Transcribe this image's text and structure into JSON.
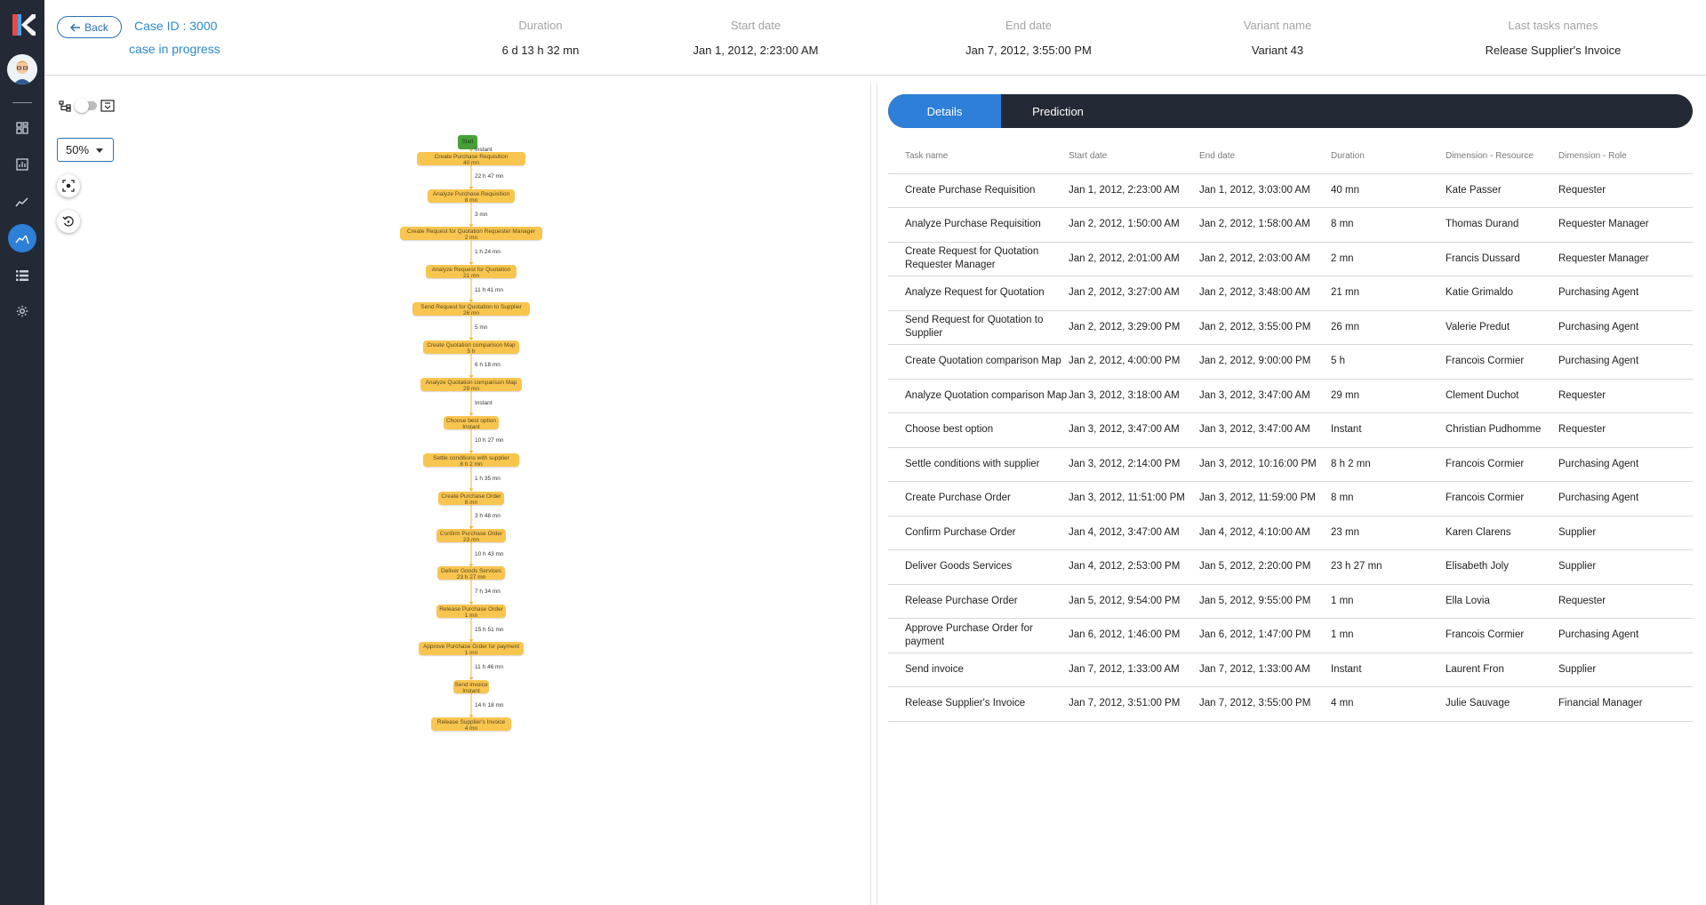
{
  "header": {
    "back_label": "Back",
    "case_id": "Case ID : 3000",
    "case_status": "case in progress",
    "columns": [
      {
        "label": "Duration",
        "value": "6 d 13 h 32 mn"
      },
      {
        "label": "Start date",
        "value": "Jan 1, 2012, 2:23:00 AM"
      },
      {
        "label": "End date",
        "value": "Jan 7, 2012, 3:55:00 PM"
      },
      {
        "label": "Variant name",
        "value": "Variant 43"
      },
      {
        "label": "Last tasks names",
        "value": "Release Supplier's Invoice"
      }
    ]
  },
  "sidebar": {
    "items": [
      {
        "icon": "dashboard-icon"
      },
      {
        "icon": "bar-chart-icon"
      },
      {
        "icon": "trend-line-icon"
      },
      {
        "icon": "process-map-icon",
        "active": true
      },
      {
        "icon": "list-icon"
      },
      {
        "icon": "gear-icon"
      }
    ]
  },
  "flow_controls": {
    "zoom": "50%"
  },
  "flow": {
    "start_label": "Start",
    "nodes": [
      {
        "name": "Create Purchase Requisition",
        "duration": "40 mn"
      },
      {
        "name": "Analyze Purchase Requisition",
        "duration": "8 mn"
      },
      {
        "name": "Create Request for Quotation Requester Manager",
        "duration": "2 mn"
      },
      {
        "name": "Analyze Request for Quotation",
        "duration": "21 mn"
      },
      {
        "name": "Send Request for Quotation to Supplier",
        "duration": "26 mn"
      },
      {
        "name": "Create Quotation comparison Map",
        "duration": "5 h"
      },
      {
        "name": "Analyze Quotation comparison Map",
        "duration": "29 mn"
      },
      {
        "name": "Choose best option",
        "duration": "Instant"
      },
      {
        "name": "Settle conditions with supplier",
        "duration": "8 h 2 mn"
      },
      {
        "name": "Create Purchase Order",
        "duration": "8 mn"
      },
      {
        "name": "Confirm Purchase Order",
        "duration": "23 mn"
      },
      {
        "name": "Deliver Goods Services",
        "duration": "23 h 27 mn"
      },
      {
        "name": "Release Purchase Order",
        "duration": "1 mn"
      },
      {
        "name": "Approve Purchase Order for payment",
        "duration": "1 mn"
      },
      {
        "name": "Send invoice",
        "duration": "Instant"
      },
      {
        "name": "Release Supplier's Invoice",
        "duration": "4 mn"
      }
    ],
    "edges": [
      "Instant",
      "22 h 47 mn",
      "3 mn",
      "1 h 24 mn",
      "11 h 41 mn",
      "5 mn",
      "6 h 18 mn",
      "Instant",
      "10 h 27 mn",
      "1 h 35 mn",
      "3 h 48 mn",
      "10 h 43 mn",
      "7 h 34 mn",
      "15 h 51 mn",
      "11 h 46 mn",
      "14 h 18 mn"
    ]
  },
  "tabs": [
    {
      "label": "Details",
      "active": true
    },
    {
      "label": "Prediction",
      "active": false
    }
  ],
  "table": {
    "columns": [
      "Task name",
      "Start date",
      "End date",
      "Duration",
      "Dimension - Resource",
      "Dimension - Role"
    ],
    "rows": [
      [
        "Create Purchase Requisition",
        "Jan 1, 2012, 2:23:00 AM",
        "Jan 1, 2012, 3:03:00 AM",
        "40 mn",
        "Kate Passer",
        "Requester"
      ],
      [
        "Analyze Purchase Requisition",
        "Jan 2, 2012, 1:50:00 AM",
        "Jan 2, 2012, 1:58:00 AM",
        "8 mn",
        "Thomas Durand",
        "Requester Manager"
      ],
      [
        "Create Request for Quotation Requester Manager",
        "Jan 2, 2012, 2:01:00 AM",
        "Jan 2, 2012, 2:03:00 AM",
        "2 mn",
        "Francis Dussard",
        "Requester Manager"
      ],
      [
        "Analyze Request for Quotation",
        "Jan 2, 2012, 3:27:00 AM",
        "Jan 2, 2012, 3:48:00 AM",
        "21 mn",
        "Katie Grimaldo",
        "Purchasing Agent"
      ],
      [
        "Send Request for Quotation to Supplier",
        "Jan 2, 2012, 3:29:00 PM",
        "Jan 2, 2012, 3:55:00 PM",
        "26 mn",
        "Valerie Predut",
        "Purchasing Agent"
      ],
      [
        "Create Quotation comparison Map",
        "Jan 2, 2012, 4:00:00 PM",
        "Jan 2, 2012, 9:00:00 PM",
        "5 h",
        "Francois Cormier",
        "Purchasing Agent"
      ],
      [
        "Analyze Quotation comparison Map",
        "Jan 3, 2012, 3:18:00 AM",
        "Jan 3, 2012, 3:47:00 AM",
        "29 mn",
        "Clement Duchot",
        "Requester"
      ],
      [
        "Choose best option",
        "Jan 3, 2012, 3:47:00 AM",
        "Jan 3, 2012, 3:47:00 AM",
        "Instant",
        "Christian Pudhomme",
        "Requester"
      ],
      [
        "Settle conditions with supplier",
        "Jan 3, 2012, 2:14:00 PM",
        "Jan 3, 2012, 10:16:00 PM",
        "8 h 2 mn",
        "Francois Cormier",
        "Purchasing Agent"
      ],
      [
        "Create Purchase Order",
        "Jan 3, 2012, 11:51:00 PM",
        "Jan 3, 2012, 11:59:00 PM",
        "8 mn",
        "Francois Cormier",
        "Purchasing Agent"
      ],
      [
        "Confirm Purchase Order",
        "Jan 4, 2012, 3:47:00 AM",
        "Jan 4, 2012, 4:10:00 AM",
        "23 mn",
        "Karen Clarens",
        "Supplier"
      ],
      [
        "Deliver Goods Services",
        "Jan 4, 2012, 2:53:00 PM",
        "Jan 5, 2012, 2:20:00 PM",
        "23 h 27 mn",
        "Elisabeth Joly",
        "Supplier"
      ],
      [
        "Release Purchase Order",
        "Jan 5, 2012, 9:54:00 PM",
        "Jan 5, 2012, 9:55:00 PM",
        "1 mn",
        "Ella Lovia",
        "Requester"
      ],
      [
        "Approve Purchase Order for payment",
        "Jan 6, 2012, 1:46:00 PM",
        "Jan 6, 2012, 1:47:00 PM",
        "1 mn",
        "Francois Cormier",
        "Purchasing Agent"
      ],
      [
        "Send invoice",
        "Jan 7, 2012, 1:33:00 AM",
        "Jan 7, 2012, 1:33:00 AM",
        "Instant",
        "Laurent Fron",
        "Supplier"
      ],
      [
        "Release Supplier's Invoice",
        "Jan 7, 2012, 3:51:00 PM",
        "Jan 7, 2012, 3:55:00 PM",
        "4 mn",
        "Julie Sauvage",
        "Financial Manager"
      ]
    ]
  },
  "colors": {
    "sidebar_bg": "#232a36",
    "accent_blue": "#2d7fd8",
    "link_blue": "#2a8bc9",
    "node_yellow": "#f8c54f",
    "start_green": "#49a03a"
  }
}
